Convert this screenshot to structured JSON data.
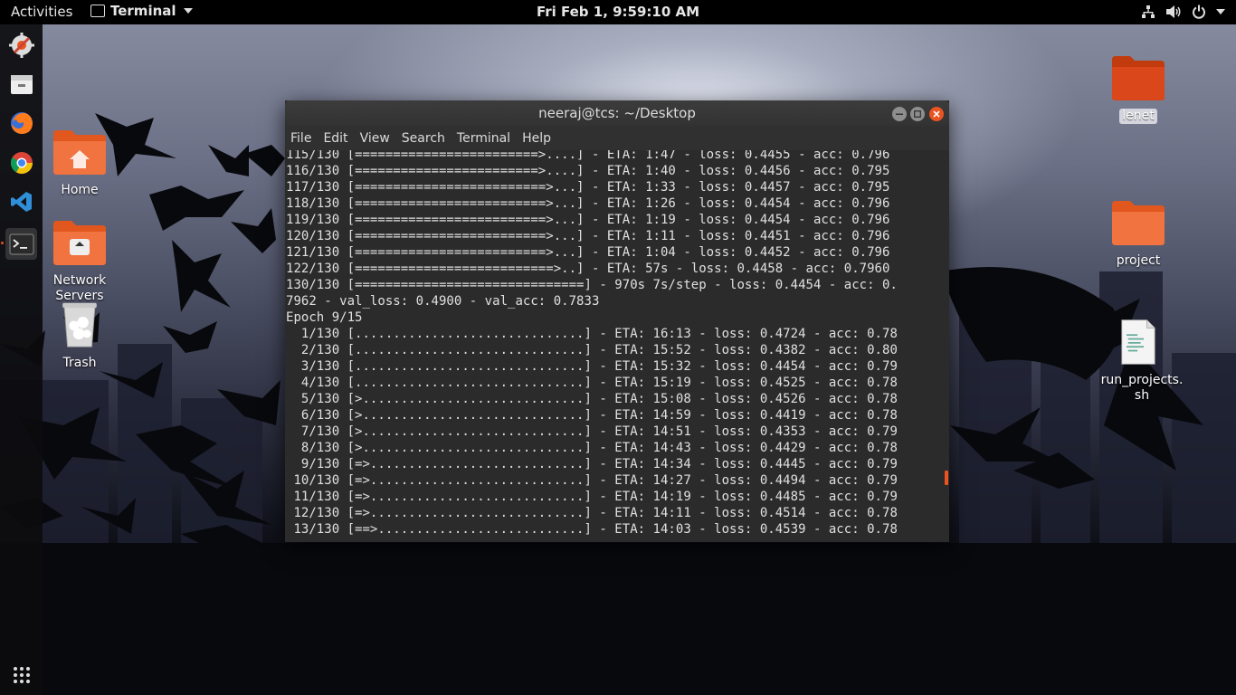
{
  "topbar": {
    "activities": "Activities",
    "app_name": "Terminal",
    "clock": "Fri Feb  1,  9:59:10 AM"
  },
  "dock": {
    "items": [
      "software-updater-icon",
      "files-icon",
      "firefox-icon",
      "chrome-icon",
      "vscode-icon",
      "terminal-icon"
    ],
    "apps_grid": "show-applications-icon"
  },
  "desktop": {
    "left_icons": [
      {
        "label": "Home"
      },
      {
        "label": "Network Servers"
      },
      {
        "label": "Trash"
      }
    ],
    "right_icons": [
      {
        "label": "lenet"
      },
      {
        "label": "project"
      },
      {
        "label": "run_projects.sh"
      }
    ]
  },
  "terminal": {
    "title": "neeraj@tcs: ~/Desktop",
    "menu": [
      "File",
      "Edit",
      "View",
      "Search",
      "Terminal",
      "Help"
    ],
    "lines": [
      "115/130 [========================>....] - ETA: 1:47 - loss: 0.4455 - acc: 0.796",
      "116/130 [========================>....] - ETA: 1:40 - loss: 0.4456 - acc: 0.795",
      "117/130 [=========================>...] - ETA: 1:33 - loss: 0.4457 - acc: 0.795",
      "118/130 [=========================>...] - ETA: 1:26 - loss: 0.4454 - acc: 0.796",
      "119/130 [=========================>...] - ETA: 1:19 - loss: 0.4454 - acc: 0.796",
      "120/130 [=========================>...] - ETA: 1:11 - loss: 0.4451 - acc: 0.796",
      "121/130 [=========================>...] - ETA: 1:04 - loss: 0.4452 - acc: 0.796",
      "122/130 [==========================>..] - ETA: 57s - loss: 0.4458 - acc: 0.7960",
      "130/130 [==============================] - 970s 7s/step - loss: 0.4454 - acc: 0.",
      "7962 - val_loss: 0.4900 - val_acc: 0.7833",
      "Epoch 9/15",
      "  1/130 [..............................] - ETA: 16:13 - loss: 0.4724 - acc: 0.78",
      "  2/130 [..............................] - ETA: 15:52 - loss: 0.4382 - acc: 0.80",
      "  3/130 [..............................] - ETA: 15:32 - loss: 0.4454 - acc: 0.79",
      "  4/130 [..............................] - ETA: 15:19 - loss: 0.4525 - acc: 0.78",
      "  5/130 [>.............................] - ETA: 15:08 - loss: 0.4526 - acc: 0.78",
      "  6/130 [>.............................] - ETA: 14:59 - loss: 0.4419 - acc: 0.78",
      "  7/130 [>.............................] - ETA: 14:51 - loss: 0.4353 - acc: 0.79",
      "  8/130 [>.............................] - ETA: 14:43 - loss: 0.4429 - acc: 0.78",
      "  9/130 [=>............................] - ETA: 14:34 - loss: 0.4445 - acc: 0.79",
      " 10/130 [=>............................] - ETA: 14:27 - loss: 0.4494 - acc: 0.79",
      " 11/130 [=>............................] - ETA: 14:19 - loss: 0.4485 - acc: 0.79",
      " 12/130 [=>............................] - ETA: 14:11 - loss: 0.4514 - acc: 0.78",
      " 13/130 [==>...........................] - ETA: 14:03 - loss: 0.4539 - acc: 0.78"
    ]
  }
}
